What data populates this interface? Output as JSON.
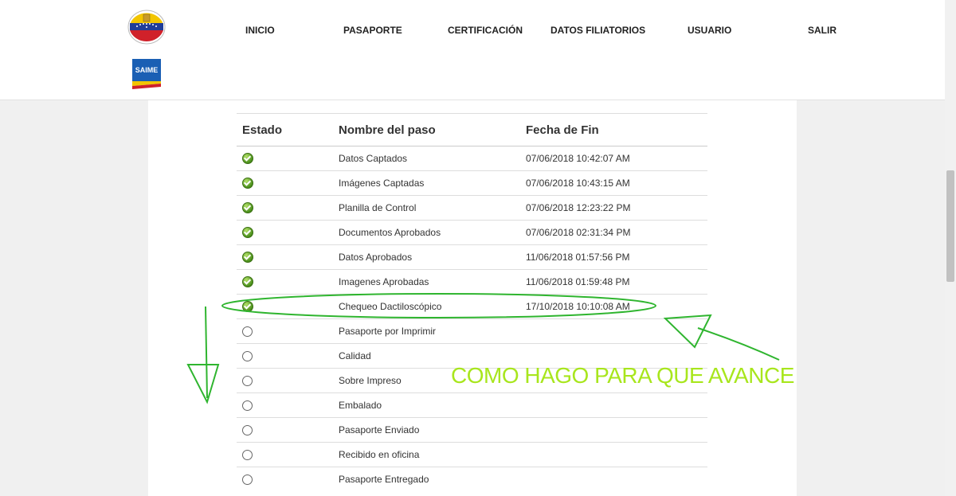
{
  "nav": {
    "items": [
      "INICIO",
      "PASAPORTE",
      "CERTIFICACIÓN",
      "DATOS FILIATORIOS",
      "USUARIO",
      "SALIR"
    ]
  },
  "brand": {
    "saime_label": "SAIME"
  },
  "table": {
    "headers": [
      "Estado",
      "Nombre del paso",
      "Fecha de Fin"
    ],
    "rows": [
      {
        "status": "done",
        "name": "Datos Captados",
        "date": "07/06/2018 10:42:07 AM"
      },
      {
        "status": "done",
        "name": "Imágenes Captadas",
        "date": "07/06/2018 10:43:15 AM"
      },
      {
        "status": "done",
        "name": "Planilla de Control",
        "date": "07/06/2018 12:23:22 PM"
      },
      {
        "status": "done",
        "name": "Documentos Aprobados",
        "date": "07/06/2018 02:31:34 PM"
      },
      {
        "status": "done",
        "name": "Datos Aprobados",
        "date": "11/06/2018 01:57:56 PM"
      },
      {
        "status": "done",
        "name": "Imagenes Aprobadas",
        "date": "11/06/2018 01:59:48 PM"
      },
      {
        "status": "done",
        "name": "Chequeo Dactiloscópico",
        "date": "17/10/2018 10:10:08 AM"
      },
      {
        "status": "pending",
        "name": "Pasaporte por Imprimir",
        "date": ""
      },
      {
        "status": "pending",
        "name": "Calidad",
        "date": ""
      },
      {
        "status": "pending",
        "name": "Sobre Impreso",
        "date": ""
      },
      {
        "status": "pending",
        "name": "Embalado",
        "date": ""
      },
      {
        "status": "pending",
        "name": "Pasaporte Enviado",
        "date": ""
      },
      {
        "status": "pending",
        "name": "Recibido en oficina",
        "date": ""
      },
      {
        "status": "pending",
        "name": "Pasaporte Entregado",
        "date": ""
      }
    ]
  },
  "annotation": {
    "text": "COMO HAGO PARA QUE AVANCE",
    "color": "#a8e61d",
    "stroke_color": "#2fb52f"
  },
  "colors": {
    "done": "#4a8f1c",
    "pending": "#ffffff"
  }
}
